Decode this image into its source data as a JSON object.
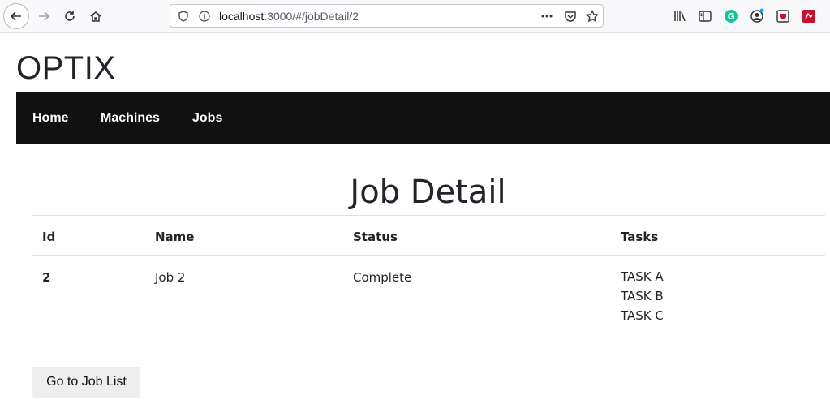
{
  "browser": {
    "url_host": "localhost",
    "url_path": ":3000/#/jobDetail/2",
    "icons": [
      "back-icon",
      "forward-icon",
      "reload-icon",
      "home-icon",
      "shield-icon",
      "info-icon",
      "more-icon",
      "pocket-icon",
      "star-icon",
      "library-icon",
      "sidebar-icon",
      "grammarly-icon",
      "account-icon",
      "ublock-icon",
      "extension-icon"
    ]
  },
  "brand": "OPTIX",
  "nav": {
    "home": "Home",
    "machines": "Machines",
    "jobs": "Jobs"
  },
  "page_title": "Job Detail",
  "table": {
    "headers": [
      "Id",
      "Name",
      "Status",
      "Tasks"
    ],
    "row": {
      "id": "2",
      "name": "Job 2",
      "status": "Complete",
      "tasks": [
        "TASK A",
        "TASK B",
        "TASK C"
      ]
    }
  },
  "button_label": "Go to Job List",
  "colors": {
    "navbar_bg": "#111111",
    "button_bg": "#eeeeee",
    "grammarly": "#15c39a",
    "ublock": "#c8102e"
  }
}
